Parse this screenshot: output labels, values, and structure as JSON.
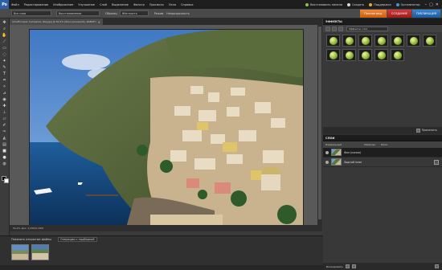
{
  "app": {
    "logo": "Ps"
  },
  "menubar": {
    "items": [
      "Файл",
      "Редактирование",
      "Изображение",
      "Улучшение",
      "Слой",
      "Выделение",
      "Фильтр",
      "Просмотр",
      "Окно",
      "Справка"
    ],
    "right": {
      "new_label": "Восстановить панели",
      "build_label": "Создать",
      "support_label": "Поддержка",
      "organizer_label": "Организатор"
    },
    "window_buttons": [
      "–",
      "▢",
      "✕"
    ]
  },
  "options_bar": {
    "field1": "Все слои",
    "field2": "Восстановление",
    "label1": "Образец",
    "field3": "Жёсткость",
    "label2": "Режим",
    "label3": "Непрозрачность"
  },
  "mode_tabs": {
    "edit": "Полное ред.",
    "create": "СОЗДАНИЕ",
    "share": "ПУБЛИКАЦИЯ"
  },
  "document": {
    "tab_label": "Amalfi Coast, Campania, Italy.jpg @ 50,2% (Фон (основной), RGB/8*)",
    "tab_close": "✕",
    "status": "50,2%  Док: 2,25M/2,25M"
  },
  "effects_panel": {
    "title": "ЭФФЕКТЫ",
    "category": "Эффекты слоя",
    "apply_label": "Применить",
    "thumbs": [
      "fx-1",
      "fx-2",
      "fx-3",
      "fx-4",
      "fx-5",
      "fx-6",
      "fx-7",
      "fx-8",
      "fx-9",
      "fx-10",
      "fx-11",
      "fx-12"
    ]
  },
  "layers_panel": {
    "title": "СЛОИ",
    "blend_mode": "Нормальный",
    "opacity_label": "Непрозр.:",
    "lock_label": "Блок:",
    "layers": [
      {
        "name": "Фон (копия)",
        "selected": true
      },
      {
        "name": "Задний план",
        "selected": false
      }
    ],
    "footer_label": "Блокировать:"
  },
  "project_bin": {
    "label": "Показать открытые файлы",
    "select": "Операции с подборкой"
  }
}
